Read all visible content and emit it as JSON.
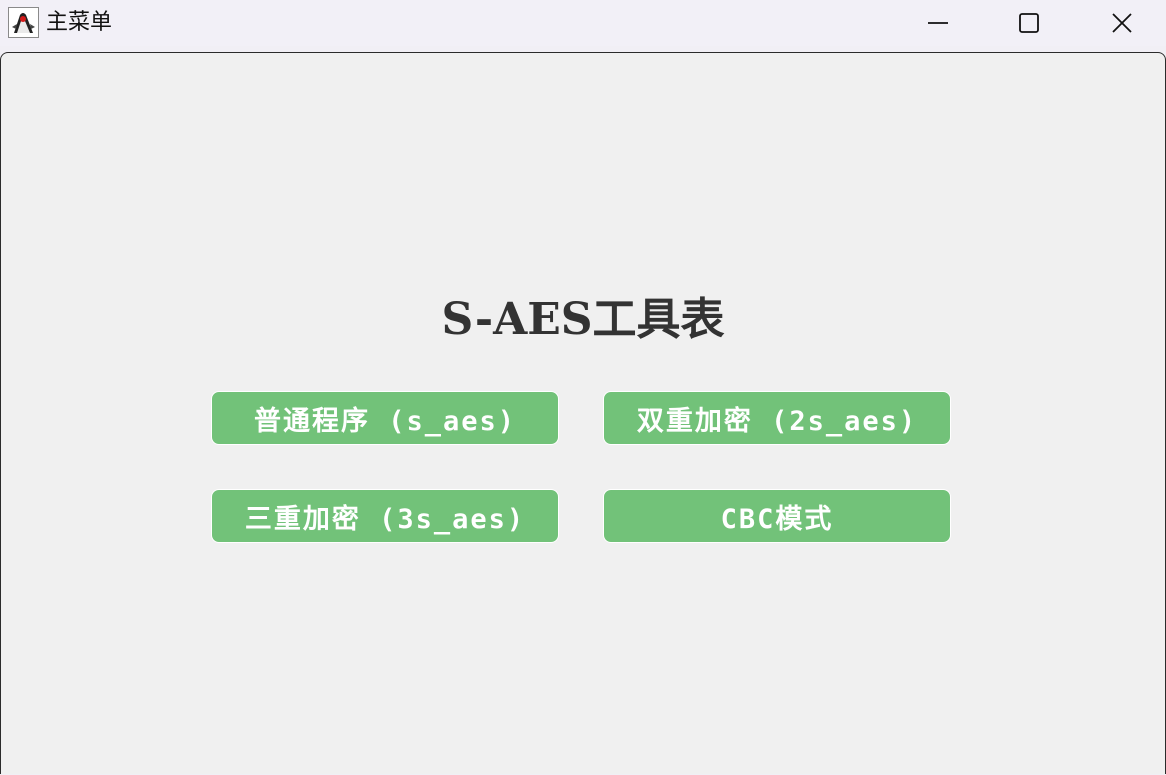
{
  "window": {
    "title": "主菜单",
    "icon": "java-duke-icon",
    "controls": [
      "minimize-icon",
      "maximize-icon",
      "close-icon"
    ]
  },
  "main": {
    "heading": "S-AES工具表",
    "buttons": [
      {
        "label": "普通程序 (s_aes)"
      },
      {
        "label": "双重加密 (2s_aes)"
      },
      {
        "label": "三重加密 (3s_aes)"
      },
      {
        "label": "CBC模式"
      }
    ]
  },
  "colors": {
    "button_bg": "#72c279",
    "button_text": "#ffffff",
    "heading_text": "#333333",
    "background": "#f0f0f0"
  }
}
